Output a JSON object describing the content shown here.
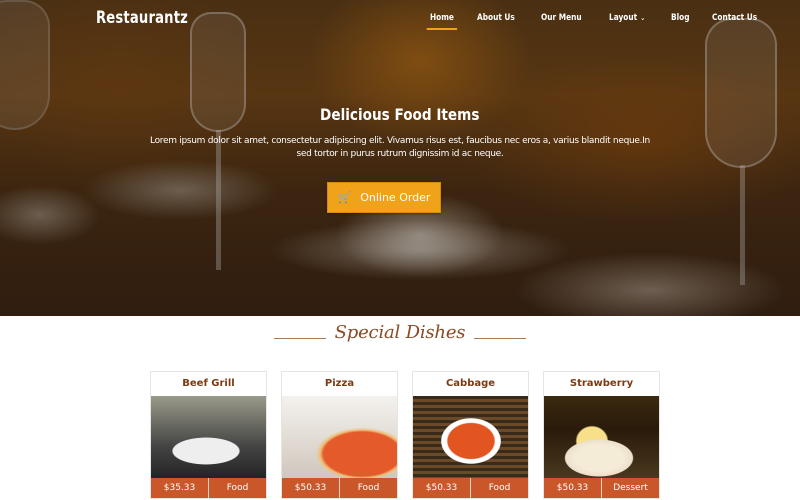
{
  "brand": {
    "name": "Restaurantz"
  },
  "nav": {
    "items": [
      {
        "label": "Home",
        "active": true
      },
      {
        "label": "About Us"
      },
      {
        "label": "Our Menu"
      },
      {
        "label": "Layout",
        "dropdown": true
      },
      {
        "label": "Blog"
      },
      {
        "label": "Contact Us"
      }
    ],
    "chevron": "⌄"
  },
  "hero": {
    "title": "Delicious Food Items",
    "text": "Lorem ipsum dolor sit amet, consectetur adipiscing elit. Vivamus risus est, faucibus nec eros a, varius blandit neque.In sed tortor in purus rutrum dignissim id ac neque.",
    "button_label": "Online Order",
    "button_icon": "cart-plus-icon",
    "accent_color": "#f0a21a"
  },
  "specials": {
    "title": "Special Dishes",
    "items": [
      {
        "name": "Beef Grill",
        "price": "$35.33",
        "category": "Food"
      },
      {
        "name": "Pizza",
        "price": "$50.33",
        "category": "Food"
      },
      {
        "name": "Cabbage",
        "price": "$50.33",
        "category": "Food"
      },
      {
        "name": "Strawberry",
        "price": "$50.33",
        "category": "Dessert"
      }
    ],
    "footer_color": "#c9572a"
  }
}
